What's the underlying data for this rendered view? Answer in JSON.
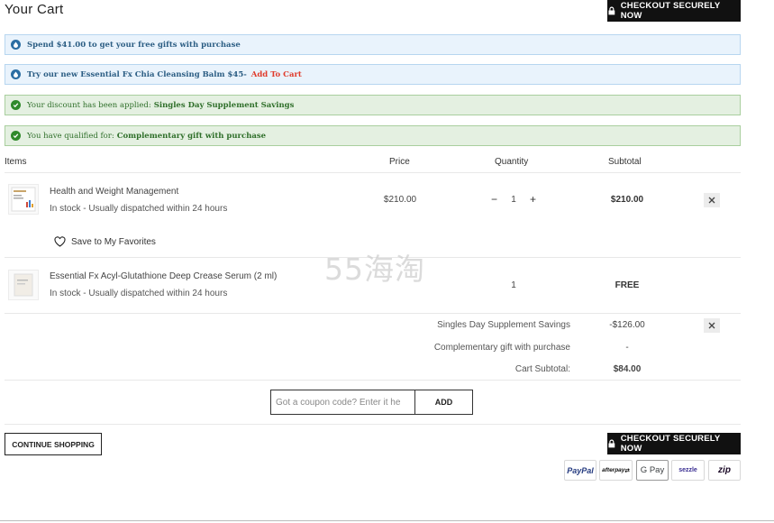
{
  "header": {
    "title": "Your Cart",
    "checkout_label": "CHECKOUT SECURELY NOW"
  },
  "notices": [
    {
      "type": "info",
      "text": "Spend $41.00 to get your free gifts with purchase"
    },
    {
      "type": "info",
      "text": "Try our new Essential Fx Chia Cleansing Balm $45-",
      "link": "Add To Cart"
    },
    {
      "type": "success",
      "prefix": "Your discount has been applied:",
      "strong": "Singles Day Supplement Savings"
    },
    {
      "type": "success",
      "prefix": "You have qualified for:",
      "strong": "Complementary gift with purchase"
    }
  ],
  "table": {
    "headers": {
      "items": "Items",
      "price": "Price",
      "quantity": "Quantity",
      "subtotal": "Subtotal"
    },
    "rows": [
      {
        "name": "Health and Weight Management",
        "stock": "In stock - Usually dispatched within 24 hours",
        "price": "$210.00",
        "quantity": "1",
        "subtotal": "$210.00",
        "favorite": "Save to My Favorites",
        "minus": "−",
        "plus": "+"
      },
      {
        "name": "Essential Fx Acyl-Glutathione Deep Crease Serum (2 ml)",
        "stock": "In stock - Usually dispatched within 24 hours",
        "quantity": "1",
        "subtotal": "FREE"
      }
    ]
  },
  "summary": [
    {
      "label": "Singles Day Supplement Savings",
      "value": "-$126.00"
    },
    {
      "label": "Complementary gift with purchase",
      "value": "-"
    },
    {
      "label": "Cart Subtotal:",
      "value": "$84.00"
    }
  ],
  "coupon": {
    "placeholder": "Got a coupon code? Enter it he",
    "add_label": "ADD"
  },
  "footer": {
    "continue_label": "CONTINUE SHOPPING"
  },
  "payment_methods": [
    {
      "name": "PayPal",
      "color": "#253b80"
    },
    {
      "name": "afterpay",
      "color": "#111111"
    },
    {
      "name": "G Pay",
      "color": "#3c4043"
    },
    {
      "name": "sezzle",
      "color": "#392d91"
    },
    {
      "name": "zip",
      "color": "#1a0826"
    }
  ],
  "watermark": "55海淘",
  "colors": {
    "info_bg": "#e9f3fc",
    "success_bg": "#e4f0e1",
    "accent_red": "#e03b2b",
    "button_dark": "#111111"
  }
}
